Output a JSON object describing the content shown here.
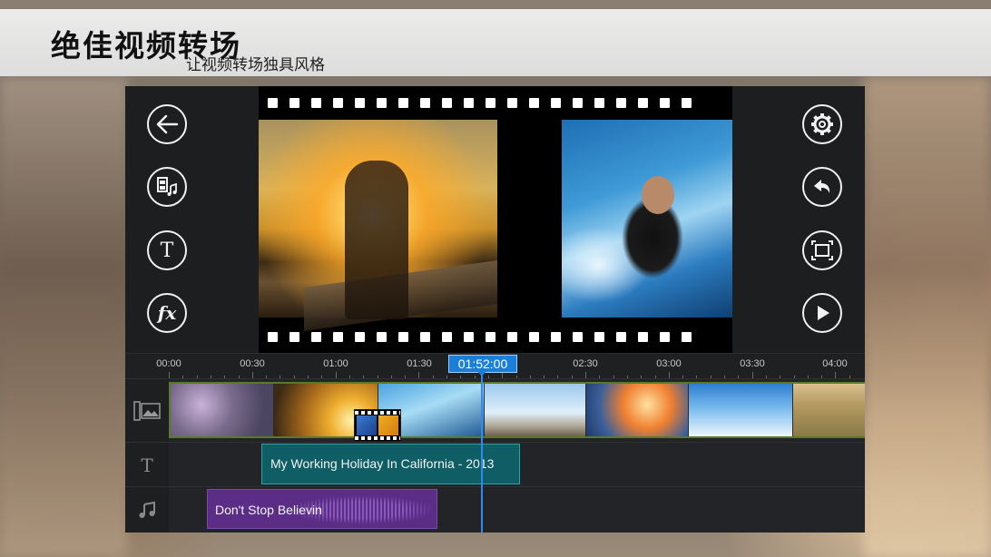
{
  "banner": {
    "title": "绝佳视频转场",
    "subtitle": "让视频转场独具风格"
  },
  "toolbar_left": [
    {
      "icon": "back-arrow-icon"
    },
    {
      "icon": "media-music-icon"
    },
    {
      "icon": "text-icon",
      "label": "T"
    },
    {
      "icon": "fx-icon",
      "label": "fx"
    }
  ],
  "toolbar_right": [
    {
      "icon": "gear-icon"
    },
    {
      "icon": "undo-icon"
    },
    {
      "icon": "fullscreen-icon"
    },
    {
      "icon": "play-icon"
    }
  ],
  "timeline": {
    "current_time": "01:52:00",
    "ticks": [
      "00:00",
      "00:30",
      "01:00",
      "01:30",
      "02:30",
      "03:00",
      "03:30",
      "04:00"
    ],
    "title_clip": "My Working Holiday In California - 2013",
    "music_clip": "Don't Stop Believin",
    "track_icons": [
      "image-track-icon",
      "text-track-icon",
      "music-track-icon"
    ],
    "text_track_glyph": "T"
  },
  "colors": {
    "accent": "#1a7fd9",
    "video_track_border": "#5a7a2a",
    "title_clip": "#0f5e66",
    "music_clip": "#5b2d86",
    "app_bg": "#1d1e20"
  }
}
